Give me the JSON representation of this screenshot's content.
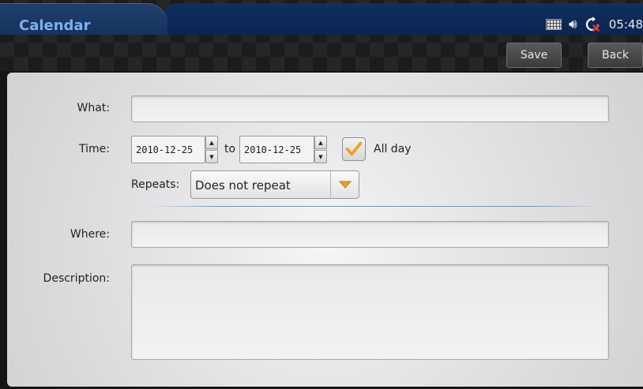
{
  "header": {
    "title": "Calendar",
    "clock": "05:48",
    "status_icons": [
      "keyboard-icon",
      "volume-icon",
      "sync-error-icon"
    ]
  },
  "toolbar": {
    "save_label": "Save",
    "back_label": "Back"
  },
  "form": {
    "what_label": "What:",
    "what_value": "",
    "time_label": "Time:",
    "start_date": "2010-12-25",
    "to_label": "to",
    "end_date": "2010-12-25",
    "all_day_label": "All day",
    "all_day_checked": true,
    "repeats_label": "Repeats:",
    "repeats_value": "Does not repeat",
    "where_label": "Where:",
    "where_value": "",
    "description_label": "Description:",
    "description_value": ""
  },
  "colors": {
    "title_text": "#7fb0ee",
    "title_bar": "#17335c",
    "check_mark": "#f0a020",
    "dropdown_arrow": "#f0a020"
  }
}
